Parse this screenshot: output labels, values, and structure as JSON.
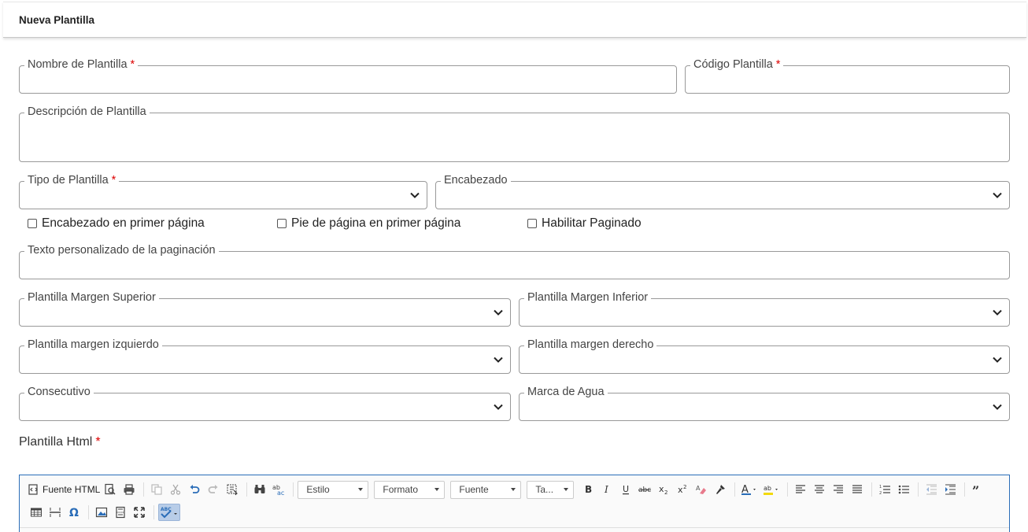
{
  "header": {
    "title": "Nueva Plantilla"
  },
  "form": {
    "nombre": {
      "label": "Nombre de Plantilla",
      "required": "*",
      "value": ""
    },
    "codigo": {
      "label": "Código Plantilla",
      "required": "*",
      "value": ""
    },
    "descripcion": {
      "label": "Descripción de Plantilla",
      "value": ""
    },
    "tipo": {
      "label": "Tipo de Plantilla",
      "required": "*",
      "value": ""
    },
    "encabezado": {
      "label": "Encabezado",
      "value": ""
    },
    "checkboxes": [
      {
        "label": "Encabezado en primer página",
        "checked": false
      },
      {
        "label": "Pie de página en primer página",
        "checked": false
      },
      {
        "label": "Habilitar Paginado",
        "checked": false
      }
    ],
    "texto_paginacion": {
      "label": "Texto personalizado de la paginación",
      "value": ""
    },
    "margen_superior": {
      "label": "Plantilla Margen Superior",
      "value": ""
    },
    "margen_inferior": {
      "label": "Plantilla Margen Inferior",
      "value": ""
    },
    "margen_izquierdo": {
      "label": "Plantilla margen izquierdo",
      "value": ""
    },
    "margen_derecho": {
      "label": "Plantilla margen derecho",
      "value": ""
    },
    "consecutivo": {
      "label": "Consecutivo",
      "value": ""
    },
    "marca_agua": {
      "label": "Marca de Agua",
      "value": ""
    },
    "plantilla_html": {
      "label": "Plantilla Html",
      "required": "*"
    }
  },
  "editor": {
    "source_label": "Fuente HTML",
    "dropdowns": {
      "estilo": "Estilo",
      "formato": "Formato",
      "fuente": "Fuente",
      "tamano": "Ta..."
    },
    "accent_color": "#2a6db8"
  }
}
